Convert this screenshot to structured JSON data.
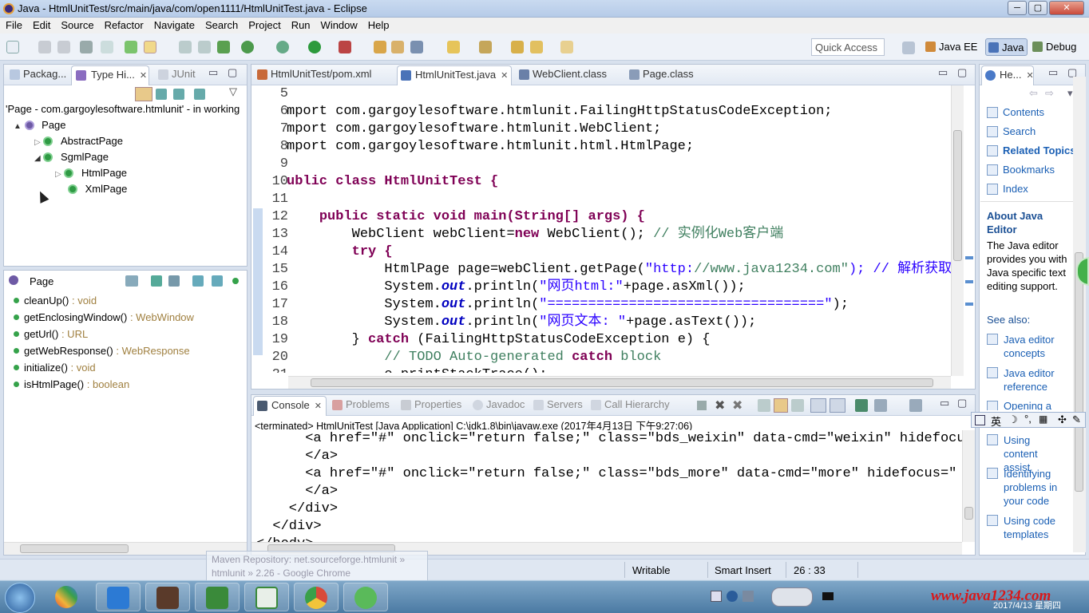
{
  "window": {
    "title": "Java - HtmlUnitTest/src/main/java/com/open1111/HtmlUnitTest.java - Eclipse",
    "min": "─",
    "max": "▢",
    "close": "✕"
  },
  "menu": [
    "File",
    "Edit",
    "Source",
    "Refactor",
    "Navigate",
    "Search",
    "Project",
    "Run",
    "Window",
    "Help"
  ],
  "toolbar": {
    "quick_access": "Quick Access",
    "perspectives": [
      "Java EE",
      "Java",
      "Debug"
    ]
  },
  "left": {
    "tabs": [
      "Packag...",
      "Type Hi...",
      "JUnit"
    ],
    "hierarchy_header": "'Page - com.gargoylesoftware.htmlunit' - in working",
    "tree": [
      {
        "label": "Page",
        "depth": 0,
        "exp": "▲"
      },
      {
        "label": "AbstractPage",
        "depth": 1,
        "exp": "▷"
      },
      {
        "label": "SgmlPage",
        "depth": 1,
        "exp": "◢"
      },
      {
        "label": "HtmlPage",
        "depth": 2,
        "exp": "▷"
      },
      {
        "label": "XmlPage",
        "depth": 2,
        "exp": ""
      }
    ],
    "outline_title": "Page",
    "methods": [
      {
        "name": "cleanUp()",
        "ret": " : void"
      },
      {
        "name": "getEnclosingWindow()",
        "ret": " : WebWindow"
      },
      {
        "name": "getUrl()",
        "ret": " : URL"
      },
      {
        "name": "getWebResponse()",
        "ret": " : WebResponse"
      },
      {
        "name": "initialize()",
        "ret": " : void"
      },
      {
        "name": "isHtmlPage()",
        "ret": " : boolean"
      }
    ]
  },
  "editor": {
    "tabs": [
      "HtmlUnitTest/pom.xml",
      "HtmlUnitTest.java",
      "WebClient.class",
      "Page.class"
    ],
    "lines": [
      {
        "n": "5",
        "html": ""
      },
      {
        "n": "6",
        "html": "mport com.gargoylesoftware.htmlunit.FailingHttpStatusCodeException;"
      },
      {
        "n": "7",
        "html": "mport com.gargoylesoftware.htmlunit.WebClient;"
      },
      {
        "n": "8",
        "html": "mport com.gargoylesoftware.htmlunit.html.HtmlPage;"
      },
      {
        "n": "9",
        "html": ""
      },
      {
        "n": "10",
        "html": "ublic class HtmlUnitTest {"
      },
      {
        "n": "11",
        "html": ""
      },
      {
        "n": "12",
        "html": "    public static void main(String[] args) {"
      },
      {
        "n": "13",
        "html": "        WebClient webClient=new WebClient(); // 实例化Web客户端"
      },
      {
        "n": "14",
        "html": "        try {"
      },
      {
        "n": "15",
        "html": "            HtmlPage page=webClient.getPage(\"http://www.java1234.com\"); // 解析获取页面"
      },
      {
        "n": "16",
        "html": "            System.out.println(\"网页html:\"+page.asXml());"
      },
      {
        "n": "17",
        "html": "            System.out.println(\"==================================\");"
      },
      {
        "n": "18",
        "html": "            System.out.println(\"网页文本: \"+page.asText());"
      },
      {
        "n": "19",
        "html": "        } catch (FailingHttpStatusCodeException e) {"
      },
      {
        "n": "20",
        "html": "            // TODO Auto-generated catch block"
      },
      {
        "n": "21",
        "html": "            e.printStackTrace();"
      }
    ]
  },
  "console": {
    "tabs": [
      "Console",
      "Problems",
      "Properties",
      "Javadoc",
      "Servers",
      "Call Hierarchy"
    ],
    "header": "<terminated> HtmlUnitTest [Java Application] C:\\jdk1.8\\bin\\javaw.exe (2017年4月13日 下午9:27:06)",
    "lines": [
      "      <a href=\"#\" onclick=\"return false;\" class=\"bds_weixin\" data-cmd=\"weixin\" hidefocus",
      "      </a>",
      "      <a href=\"#\" onclick=\"return false;\" class=\"bds_more\" data-cmd=\"more\" hidefocus=\"",
      "      </a>",
      "    </div>",
      "  </div>",
      "</body>"
    ]
  },
  "help": {
    "tab": "He...",
    "links": [
      "Contents",
      "Search",
      "Related Topics",
      "Bookmarks",
      "Index"
    ],
    "about_title": "About Java Editor",
    "about_text": "The Java editor provides you with Java specific text editing support.",
    "see_also": "See also:",
    "see_links": [
      "Java editor concepts",
      "Java editor reference",
      "Opening a",
      "Using content assist",
      "Identifying problems in your code",
      "Using code templates"
    ]
  },
  "ime": "英",
  "tooltip": {
    "line1": "Maven Repository: net.sourceforge.htmlunit »",
    "line2": "htmlunit » 2.26 - Google Chrome"
  },
  "status": {
    "writable": "Writable",
    "insert": "Smart Insert",
    "position": "26 : 33"
  },
  "taskbar": {
    "watermark": "www.java1234.com",
    "date": "2017/4/13 星期四"
  }
}
